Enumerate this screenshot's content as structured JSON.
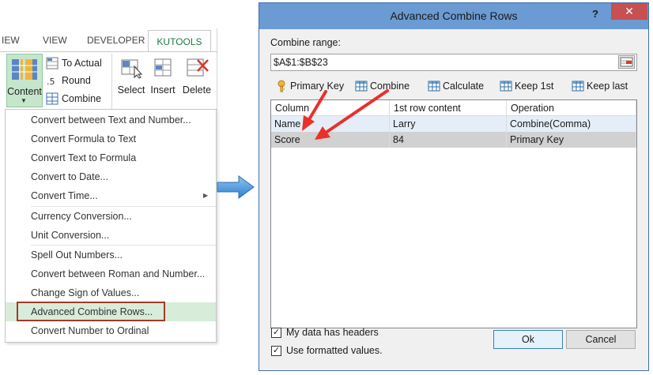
{
  "ribbon": {
    "tabs": [
      "IEW",
      "VIEW",
      "DEVELOPER"
    ],
    "active_tab": "KUTOOLS",
    "content_button": "Content",
    "small_buttons": [
      "To Actual",
      "Round",
      "Combine"
    ],
    "big_buttons": [
      "Select",
      "Insert",
      "Delete"
    ]
  },
  "menu": {
    "items": [
      "Convert between Text and Number...",
      "Convert Formula to Text",
      "Convert Text to Formula",
      "Convert to Date...",
      "Convert Time...",
      "Currency Conversion...",
      "Unit Conversion...",
      "Spell Out Numbers...",
      "Convert between Roman and Number...",
      "Change Sign of Values...",
      "Advanced Combine Rows...",
      "Convert Number to Ordinal"
    ],
    "highlighted_index": 10
  },
  "dialog": {
    "title": "Advanced Combine Rows",
    "help": "?",
    "close": "✕",
    "range_label": "Combine range:",
    "range_value": "$A$1:$B$23",
    "toolbar": [
      "Primary Key",
      "Combine",
      "Calculate",
      "Keep 1st",
      "Keep last"
    ],
    "columns": [
      "Column",
      "1st row content",
      "Operation"
    ],
    "rows": [
      {
        "column": "Name",
        "first": "Larry",
        "operation": "Combine(Comma)"
      },
      {
        "column": "Score",
        "first": "84",
        "operation": "Primary Key"
      }
    ],
    "checkboxes": [
      {
        "label": "My data has headers",
        "checked": true,
        "mark": "✓"
      },
      {
        "label": "Use formatted values.",
        "checked": true,
        "mark": "✓"
      }
    ],
    "ok": "Ok",
    "cancel": "Cancel"
  },
  "colors": {
    "kutools_green": "#1d7a3e",
    "highlight_box": "#a23a2a",
    "annotation_arrow": "#e8312a",
    "title_bar": "#6b9bd2",
    "close_red": "#c75050",
    "arrow_blue": "#3d8fd6"
  }
}
